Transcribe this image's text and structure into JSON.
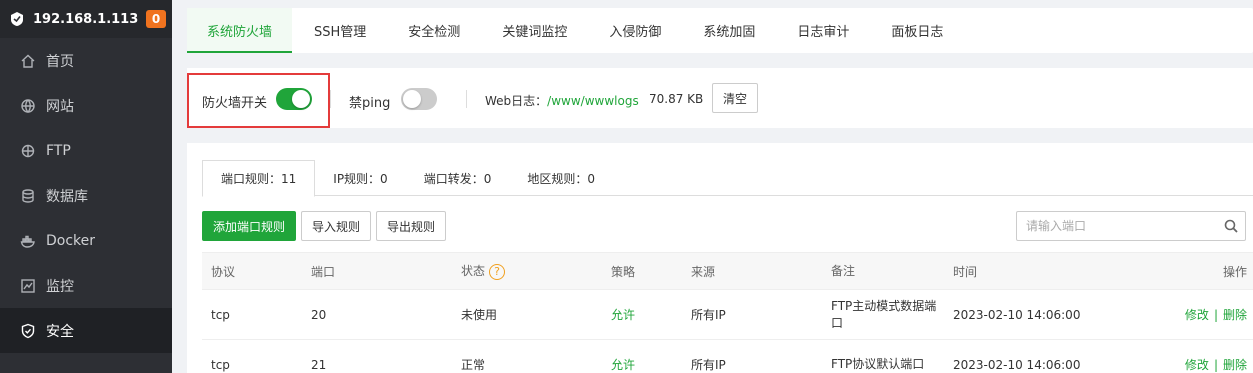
{
  "sidebar": {
    "ip": "192.168.1.113",
    "badge": "0",
    "items": [
      {
        "label": "首页",
        "icon": "home-icon"
      },
      {
        "label": "网站",
        "icon": "globe-icon"
      },
      {
        "label": "FTP",
        "icon": "ftp-icon"
      },
      {
        "label": "数据库",
        "icon": "database-icon"
      },
      {
        "label": "Docker",
        "icon": "docker-icon"
      },
      {
        "label": "监控",
        "icon": "monitor-icon"
      },
      {
        "label": "安全",
        "icon": "shield-icon"
      }
    ]
  },
  "top_tabs": [
    "系统防火墙",
    "SSH管理",
    "安全检测",
    "关键词监控",
    "入侵防御",
    "系统加固",
    "日志审计",
    "面板日志"
  ],
  "switch_bar": {
    "firewall_label": "防火墙开关",
    "firewall_on": true,
    "ping_label": "禁ping",
    "ping_on": false,
    "web_log_label": "Web日志：",
    "web_log_path": "/www/wwwlogs",
    "web_log_size": "70.87 KB",
    "clear_button": "清空"
  },
  "rule_tabs": [
    "端口规则：11",
    "IP规则：0",
    "端口转发：0",
    "地区规则：0"
  ],
  "buttons": {
    "add": "添加端口规则",
    "import": "导入规则",
    "export": "导出规则"
  },
  "search": {
    "placeholder": "请输入端口",
    "value": ""
  },
  "table": {
    "headers": [
      "协议",
      "端口",
      "状态",
      "策略",
      "来源",
      "备注",
      "时间",
      "操作"
    ],
    "rows": [
      {
        "protocol": "tcp",
        "port": "20",
        "status": "未使用",
        "policy": "允许",
        "source": "所有IP",
        "note": "FTP主动模式数据端口",
        "time": "2023-02-10 14:06:00",
        "edit": "修改",
        "delete": "删除"
      },
      {
        "protocol": "tcp",
        "port": "21",
        "status": "正常",
        "policy": "允许",
        "source": "所有IP",
        "note": "FTP协议默认端口",
        "time": "2023-02-10 14:06:00",
        "edit": "修改",
        "delete": "删除"
      }
    ]
  },
  "colors": {
    "accent": "#20a53a",
    "sidebar_bg": "#2d2f34",
    "highlight_border": "#e43b3b",
    "badge": "#f0731f"
  }
}
